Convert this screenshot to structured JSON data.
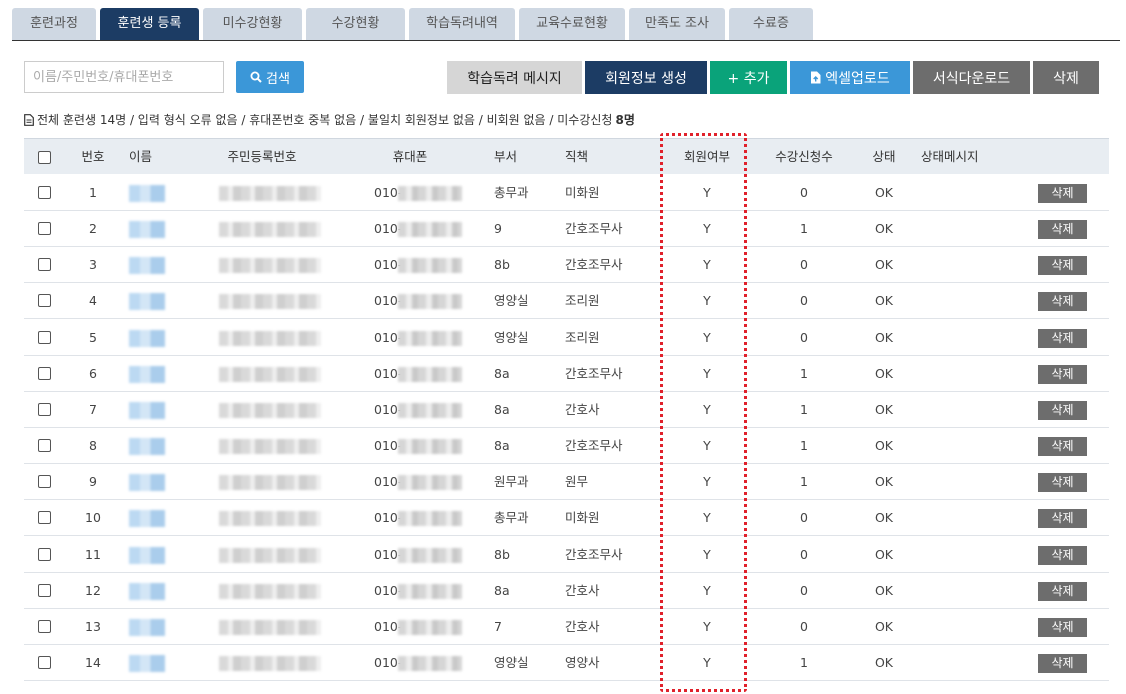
{
  "tabs": [
    {
      "label": "훈련과정"
    },
    {
      "label": "훈련생 등록"
    },
    {
      "label": "미수강현황"
    },
    {
      "label": "수강현황"
    },
    {
      "label": "학습독려내역"
    },
    {
      "label": "교육수료현황"
    },
    {
      "label": "만족도 조사"
    },
    {
      "label": "수료증"
    }
  ],
  "search": {
    "placeholder": "이름/주민번호/휴대폰번호",
    "button_label": "검색"
  },
  "toolbar": {
    "reminder_label": "학습독려 메시지",
    "create_member_label": "회원정보 생성",
    "add_label": "+ 추가",
    "excel_upload_label": "엑셀업로드",
    "template_download_label": "서식다운로드",
    "delete_label": "삭제"
  },
  "summary": {
    "text": "전체 훈련생 14명 / 입력 형식 오류 없음 / 휴대폰번호 중복 없음 / 불일치 회원정보 없음 / 비회원 없음 / 미수강신청",
    "count": "8명"
  },
  "table": {
    "headers": {
      "no": "번호",
      "name": "이름",
      "rrn": "주민등록번호",
      "phone": "휴대폰",
      "dept": "부서",
      "title": "직책",
      "member": "회원여부",
      "enroll": "수강신청수",
      "status": "상태",
      "message": "상태메시지"
    },
    "phone_prefix": "010-",
    "delete_label": "삭제",
    "rows": [
      {
        "no": "1",
        "dept": "총무과",
        "title": "미화원",
        "member": "Y",
        "enroll": "0",
        "status": "OK"
      },
      {
        "no": "2",
        "dept": "9",
        "title": "간호조무사",
        "member": "Y",
        "enroll": "1",
        "status": "OK"
      },
      {
        "no": "3",
        "dept": "8b",
        "title": "간호조무사",
        "member": "Y",
        "enroll": "0",
        "status": "OK"
      },
      {
        "no": "4",
        "dept": "영양실",
        "title": "조리원",
        "member": "Y",
        "enroll": "0",
        "status": "OK"
      },
      {
        "no": "5",
        "dept": "영양실",
        "title": "조리원",
        "member": "Y",
        "enroll": "0",
        "status": "OK"
      },
      {
        "no": "6",
        "dept": "8a",
        "title": "간호조무사",
        "member": "Y",
        "enroll": "1",
        "status": "OK"
      },
      {
        "no": "7",
        "dept": "8a",
        "title": "간호사",
        "member": "Y",
        "enroll": "1",
        "status": "OK"
      },
      {
        "no": "8",
        "dept": "8a",
        "title": "간호조무사",
        "member": "Y",
        "enroll": "1",
        "status": "OK"
      },
      {
        "no": "9",
        "dept": "원무과",
        "title": "원무",
        "member": "Y",
        "enroll": "1",
        "status": "OK"
      },
      {
        "no": "10",
        "dept": "총무과",
        "title": "미화원",
        "member": "Y",
        "enroll": "0",
        "status": "OK"
      },
      {
        "no": "11",
        "dept": "8b",
        "title": "간호조무사",
        "member": "Y",
        "enroll": "0",
        "status": "OK"
      },
      {
        "no": "12",
        "dept": "8a",
        "title": "간호사",
        "member": "Y",
        "enroll": "0",
        "status": "OK"
      },
      {
        "no": "13",
        "dept": "7",
        "title": "간호사",
        "member": "Y",
        "enroll": "0",
        "status": "OK"
      },
      {
        "no": "14",
        "dept": "영양실",
        "title": "영양사",
        "member": "Y",
        "enroll": "1",
        "status": "OK"
      }
    ]
  },
  "colors": {
    "tab_active": "#1c3c64",
    "tab_inactive": "#cfd8e3",
    "search_button": "#3b97d8",
    "reminder_button": "#d6d6d6",
    "create_member_button": "#1c3c64",
    "add_button": "#0aa37a",
    "excel_button": "#3b97d8",
    "template_button": "#6d6d6d",
    "delete_button": "#6d6d6d",
    "highlight_border": "#e0212b"
  }
}
